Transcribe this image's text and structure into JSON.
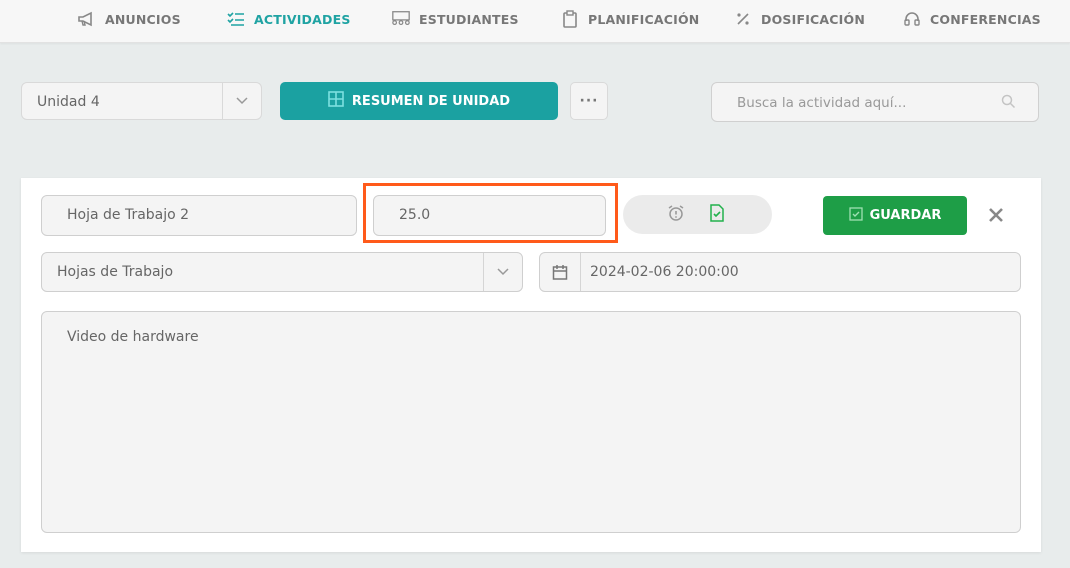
{
  "nav": [
    {
      "label": "ANUNCIOS",
      "icon": "megaphone-icon",
      "active": false
    },
    {
      "label": "ACTIVIDADES",
      "icon": "checklist-icon",
      "active": true
    },
    {
      "label": "ESTUDIANTES",
      "icon": "students-icon",
      "active": false
    },
    {
      "label": "PLANIFICACIÓN",
      "icon": "clipboard-icon",
      "active": false
    },
    {
      "label": "DOSIFICACIÓN",
      "icon": "percent-icon",
      "active": false
    },
    {
      "label": "CONFERENCIAS",
      "icon": "headset-icon",
      "active": false
    }
  ],
  "toolbar": {
    "unit_value": "Unidad 4",
    "summary_label": "RESUMEN DE UNIDAD",
    "more_label": "···",
    "search_placeholder": "Busca la actividad aquí..."
  },
  "form": {
    "title_value": "Hoja de Trabajo 2",
    "points_value": "25.0",
    "save_label": "GUARDAR",
    "type_value": "Hojas de Trabajo",
    "date_value": "2024-02-06 20:00:00",
    "description_value": "Video de hardware"
  },
  "colors": {
    "accent": "#1ba1a1",
    "save": "#1e9e47",
    "highlight": "#ff5a1a"
  }
}
